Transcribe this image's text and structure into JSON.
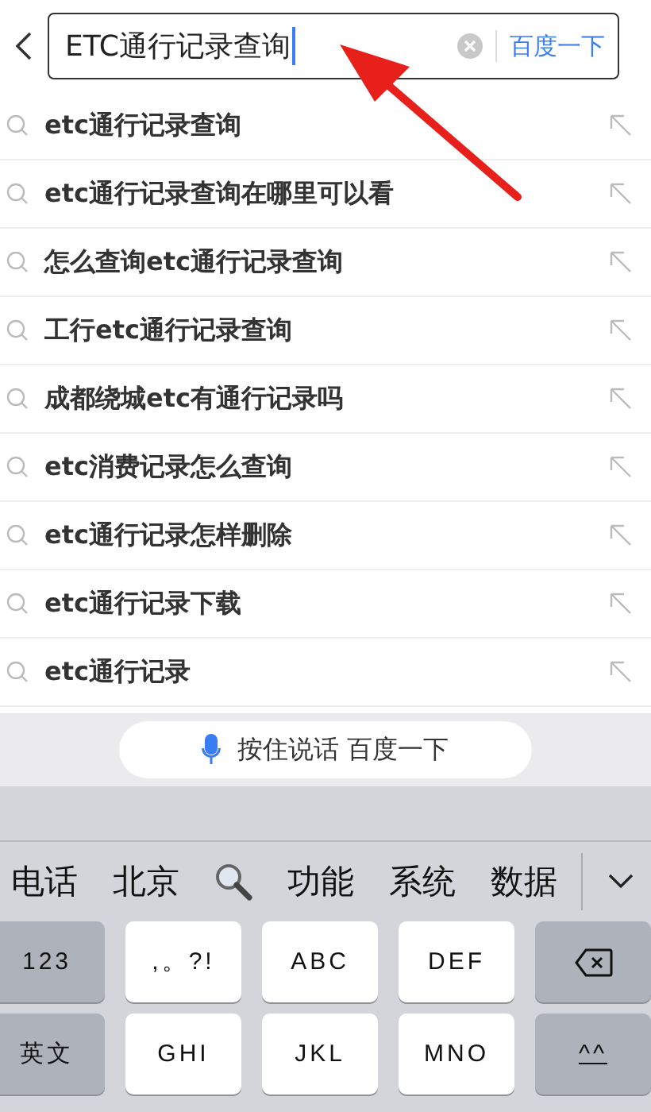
{
  "search": {
    "value": "ETC通行记录查询",
    "submit": "百度一下"
  },
  "suggestions": [
    {
      "text": "etc通行记录查询"
    },
    {
      "text": "etc通行记录查询在哪里可以看"
    },
    {
      "text": "怎么查询etc通行记录查询"
    },
    {
      "text": "工行etc通行记录查询"
    },
    {
      "text": "成都绕城etc有通行记录吗"
    },
    {
      "text": "etc消费记录怎么查询"
    },
    {
      "text": "etc通行记录怎样删除"
    },
    {
      "text": "etc通行记录下载"
    },
    {
      "text": "etc通行记录"
    }
  ],
  "voice_button": "按住说话 百度一下",
  "candidates": [
    {
      "kind": "text",
      "label": "电话"
    },
    {
      "kind": "text",
      "label": "北京"
    },
    {
      "kind": "search"
    },
    {
      "kind": "text",
      "label": "功能"
    },
    {
      "kind": "text",
      "label": "系统"
    },
    {
      "kind": "text",
      "label": "数据"
    }
  ],
  "keys": [
    [
      {
        "kind": "function",
        "label": "123"
      },
      {
        "kind": "letter",
        "label": ",。?!"
      },
      {
        "kind": "letter",
        "label": "ABC"
      },
      {
        "kind": "letter",
        "label": "DEF"
      },
      {
        "kind": "backspace"
      }
    ],
    [
      {
        "kind": "function",
        "label": "英文"
      },
      {
        "kind": "letter",
        "label": "GHI"
      },
      {
        "kind": "letter",
        "label": "JKL"
      },
      {
        "kind": "letter",
        "label": "MNO"
      },
      {
        "kind": "emoticon",
        "label": "^^"
      }
    ]
  ]
}
